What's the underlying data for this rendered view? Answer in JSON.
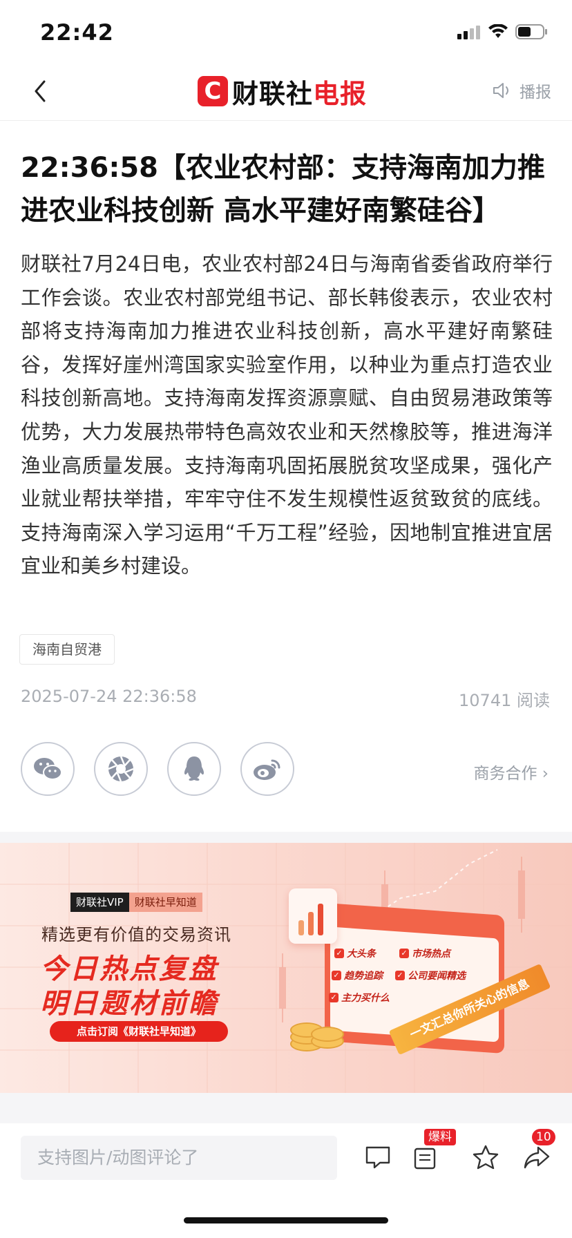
{
  "status_bar": {
    "time": "22:42"
  },
  "nav": {
    "brand_left": "财联社",
    "brand_right": "电报",
    "brand_logo_letter": "C",
    "broadcast_label": "播报"
  },
  "article": {
    "title": "22:36:58【农业农村部：支持海南加力推进农业科技创新 高水平建好南繁硅谷】",
    "body": "财联社7月24日电，农业农村部24日与海南省委省政府举行工作会谈。农业农村部党组书记、部长韩俊表示，农业农村部将支持海南加力推进农业科技创新，高水平建好南繁硅谷，发挥好崖州湾国家实验室作用，以种业为重点打造农业科技创新高地。支持海南发挥资源禀赋、自由贸易港政策等优势，大力发展热带特色高效农业和天然橡胶等，推进海洋渔业高质量发展。支持海南巩固拓展脱贫攻坚成果，强化产业就业帮扶举措，牢牢守住不发生规模性返贫致贫的底线。支持海南深入学习运用“千万工程”经验，因地制宜推进宜居宜业和美乡村建设。",
    "tag": "海南自贸港",
    "date": "2025-07-24 22:36:58",
    "reads": "10741 阅读"
  },
  "share": {
    "items": [
      "wechat-icon",
      "moments-icon",
      "qq-icon",
      "weibo-icon"
    ],
    "business_link": "商务合作 ›"
  },
  "banner": {
    "vip_tag": "财联社VIP",
    "product_tag": "财联社早知道",
    "subtitle": "精选更有价值的交易资讯",
    "headline_1": "今日热点复盘",
    "headline_2": "明日题材前瞻",
    "cta": "点击订阅《财联社早知道》",
    "checklist": [
      "大头条",
      "市场热点",
      "趋势追踪",
      "公司要闻精选",
      "主力买什么"
    ],
    "ribbon": "一文汇总你所关心的信息"
  },
  "comment_bar": {
    "placeholder": "支持图片/动图评论了",
    "report_badge": "爆料",
    "share_count": "10"
  },
  "colors": {
    "brand_red": "#e8212a",
    "muted_gray": "#a9adb3"
  }
}
